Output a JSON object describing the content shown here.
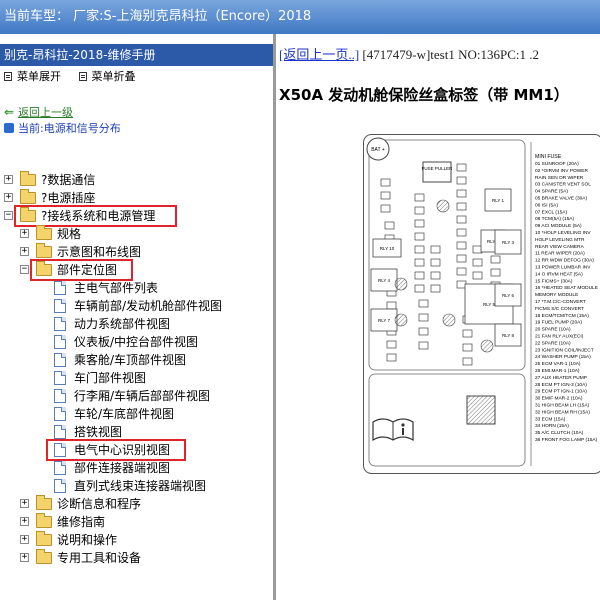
{
  "titlebar": {
    "text": "当前车型：  厂家:S-上海别克昂科拉（Encore）2018"
  },
  "left": {
    "header": "别克-昂科拉-2018-维修手册",
    "toolbar": {
      "expand": "菜单展开",
      "collapse": "菜单折叠"
    },
    "back": "返回上一级",
    "current": "当前:电源和信号分布",
    "tree": [
      {
        "label": "?数据通信",
        "type": "folder",
        "exp": "+"
      },
      {
        "label": "?电源插座",
        "type": "folder",
        "exp": "+"
      },
      {
        "label": "?接线系统和电源管理",
        "type": "folder",
        "exp": "−",
        "open": true,
        "highlight": true
      },
      {
        "label": "规格",
        "type": "folder",
        "exp": "+"
      },
      {
        "label": "示意图和布线图",
        "type": "folder",
        "exp": "+"
      },
      {
        "label": "部件定位图",
        "type": "folder",
        "exp": "−",
        "open": true,
        "highlight": true
      },
      {
        "label": "主电气部件列表",
        "type": "doc"
      },
      {
        "label": "车辆前部/发动机舱部件视图",
        "type": "doc"
      },
      {
        "label": "动力系统部件视图",
        "type": "doc"
      },
      {
        "label": "仪表板/中控台部件视图",
        "type": "doc"
      },
      {
        "label": "乘客舱/车顶部件视图",
        "type": "doc"
      },
      {
        "label": "车门部件视图",
        "type": "doc"
      },
      {
        "label": "行李厢/车辆后部部件视图",
        "type": "doc"
      },
      {
        "label": "车轮/车底部件视图",
        "type": "doc"
      },
      {
        "label": "搭铁视图",
        "type": "doc"
      },
      {
        "label": "电气中心识别视图",
        "type": "doc",
        "highlight": true
      },
      {
        "label": "部件连接器端视图",
        "type": "doc"
      },
      {
        "label": "直列式线束连接器端视图",
        "type": "doc"
      },
      {
        "label": "诊断信息和程序",
        "type": "folder",
        "exp": "+"
      },
      {
        "label": "维修指南",
        "type": "folder",
        "exp": "+"
      },
      {
        "label": "说明和操作",
        "type": "folder",
        "exp": "+"
      },
      {
        "label": "专用工具和设备",
        "type": "folder",
        "exp": "+"
      }
    ]
  },
  "right": {
    "back_link": "[返回上一页..]",
    "info": " [4717479-w]test1 NO:136PC:1 .2",
    "title": "X50A 发动机舱保险丝盒标签（带 MM1）"
  },
  "diagram": {
    "bat": "BAT +",
    "fuse_puller": "FUSE PULLER",
    "relays": [
      "RLY 1",
      "RLY 2",
      "RLY 3",
      "RLY 4",
      "RLY 5",
      "RLY 6",
      "RLY 7",
      "RLY 8",
      "RLY 10"
    ],
    "legend_title": "MINI FUSE",
    "legend": [
      "01 SUNROOF (20A)",
      "02 *OIRVM INV POWER",
      "   RAIN SEN OR WIPER",
      "03 CANISTER VENT SOL",
      "04 SPARE (5A)",
      "05 BRAKE VALVE (30A)",
      "06 ISI (5A)",
      "07 EXCL (15A)",
      "08 TCM(5A) (15A)",
      "09 ACI MODULE (5A)",
      "10 *HOLP LEVELING INV",
      "   HOLP LEVELING MTR",
      "   REAR VIEW CAMERA",
      "11 REAR WIPER (20A)",
      "12 RR WDW DEFOG (30A)",
      "13 POWER LUMBAR INV",
      "14 O IRVM HEAT (5A)",
      "15 FICMS+ (30A)",
      "16 *HEATED SEAT MODULE",
      "   MEMORY MODULE",
      "17 *T.M.C/C-CONVERT",
      "   FICMS S/C CONVERT",
      "18 ECM/TCM/TCM (15A)",
      "19 FUEL PUMP (20A)",
      "20 SPARE (10A)",
      "21 FAN RLY AUX(ECI)",
      "22 SPARE (10A)",
      "23 IGNITION COIL/INJECT",
      "24 WASHER PUMP (15A)",
      "25 ECM VAR-1 (10A)",
      "26 EMI.MAR-1 (10A)",
      "27 AUX HEATER PUMP",
      "28 ECM PT IGN-2 (10A)",
      "29 ECM PT IGN-1 (10A)",
      "30 EMIF MAR-2 (10A)",
      "31 HIGH BEAM LH (15A)",
      "32 HIGH BEAM RH (15A)",
      "33 ECM (15A)",
      "34 HORN (15A)",
      "35 A/C CLUTCH (10A)",
      "36 FRONT FOG LAMP (15A)"
    ]
  }
}
